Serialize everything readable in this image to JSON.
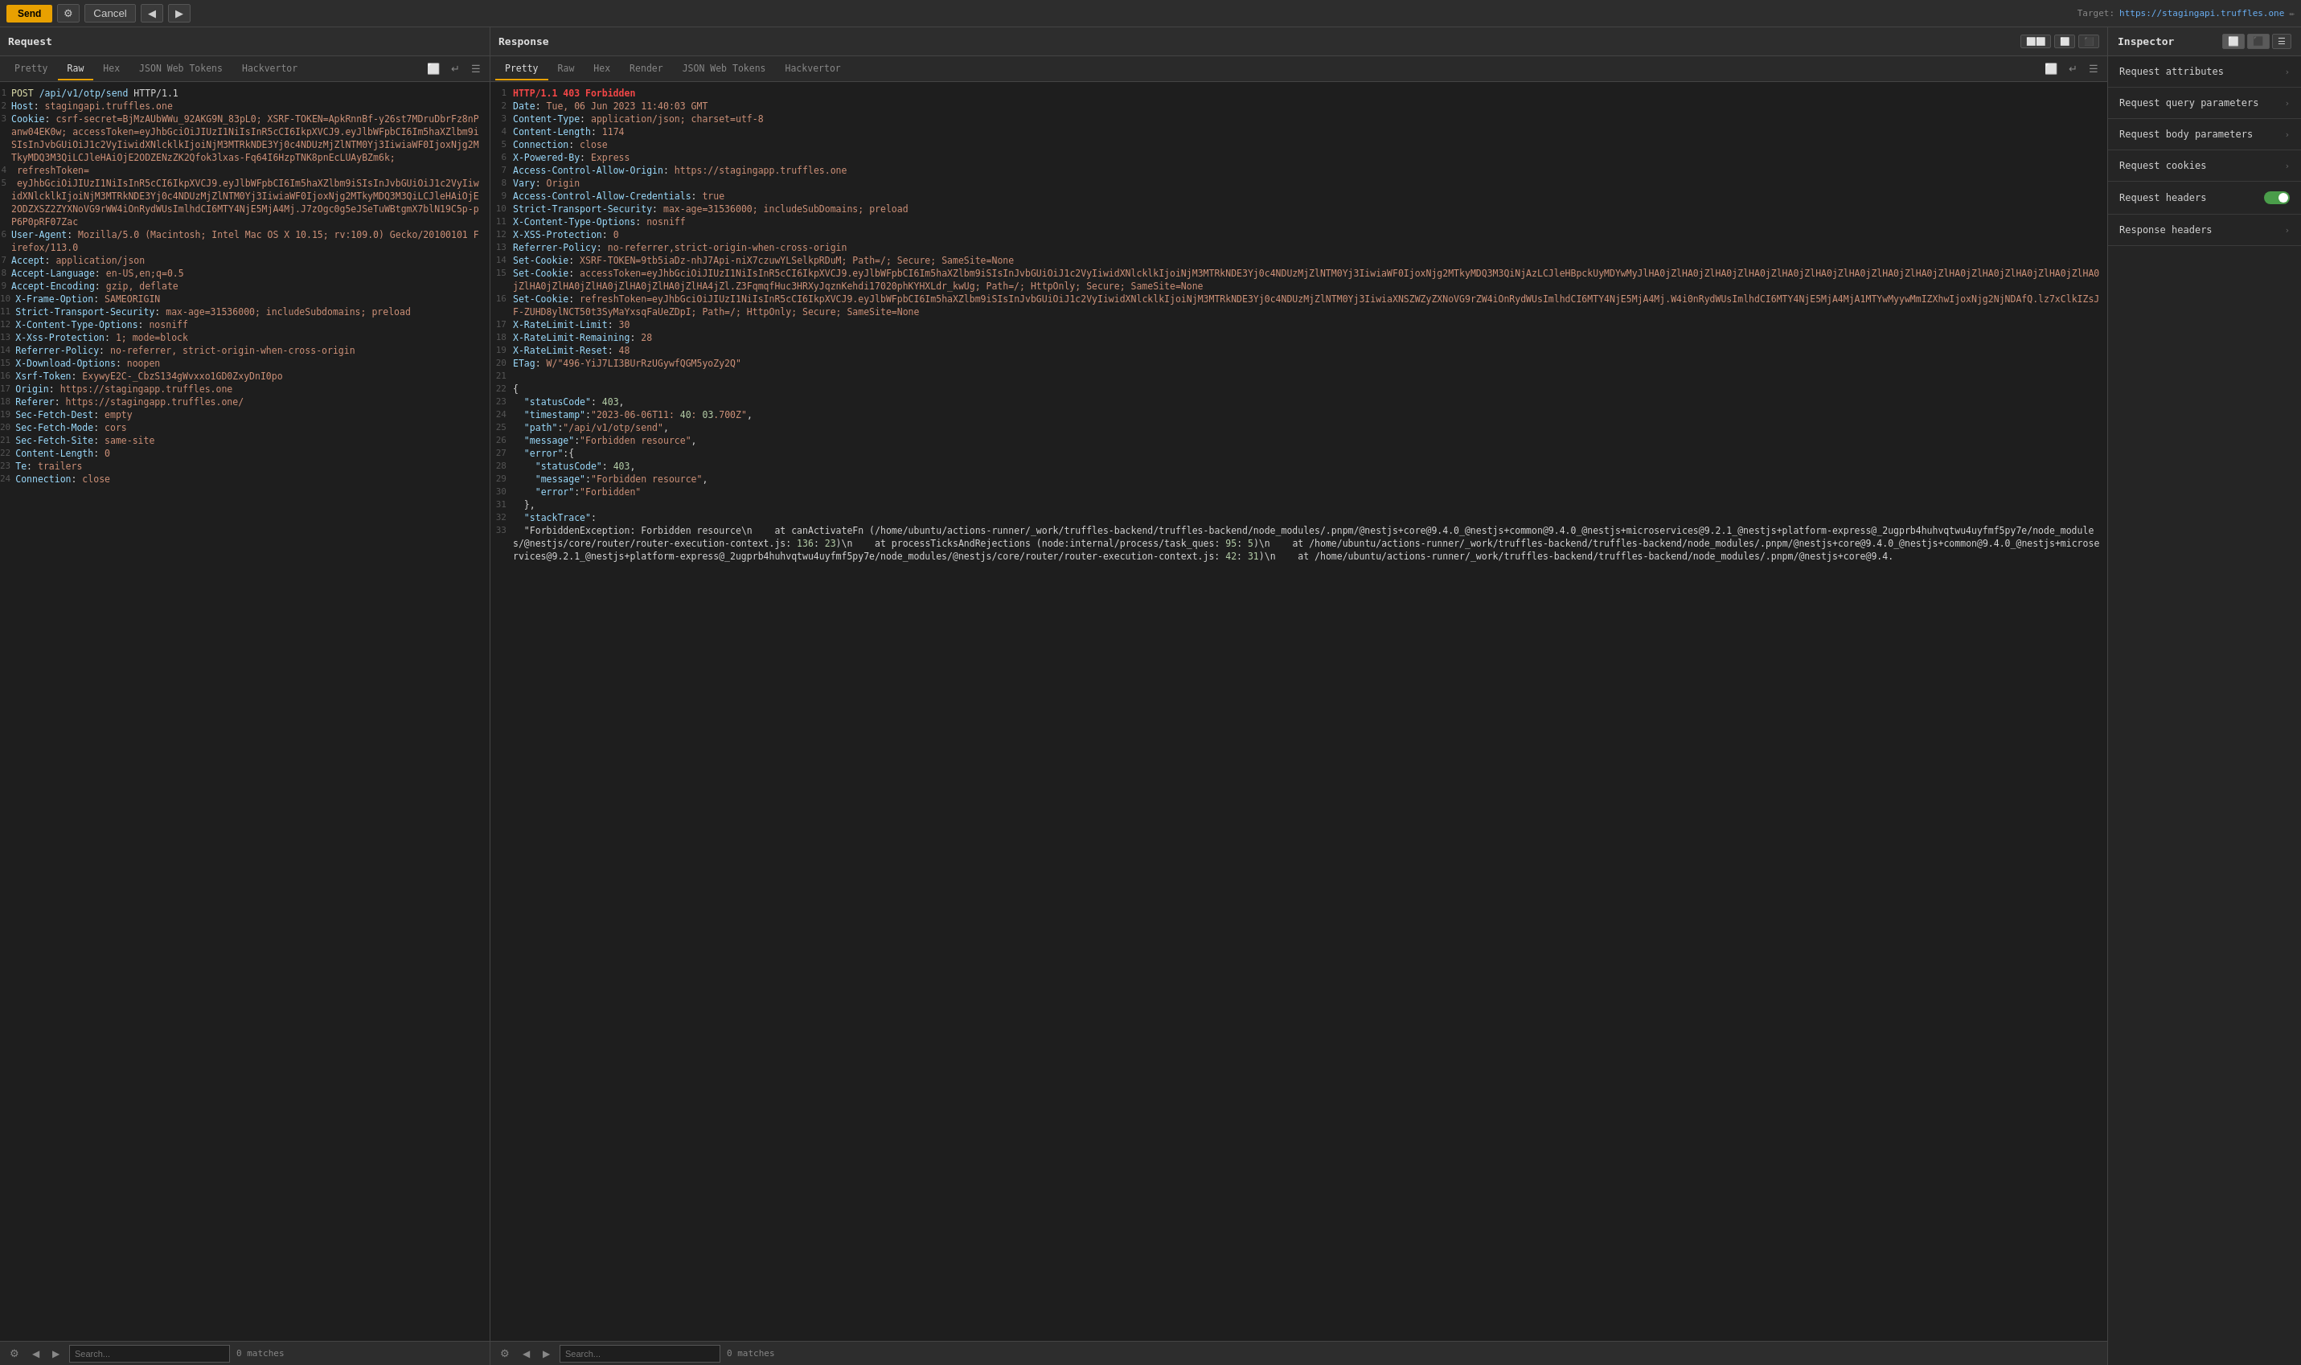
{
  "toolbar": {
    "send_label": "Send",
    "cancel_label": "Cancel",
    "target_prefix": "Target: ",
    "target_url": "https://stagingapi.truffles.one"
  },
  "request_panel": {
    "title": "Request",
    "tabs": [
      "Pretty",
      "Raw",
      "Hex",
      "JSON Web Tokens",
      "Hackvertor"
    ],
    "active_tab": "Raw"
  },
  "response_panel": {
    "title": "Response",
    "tabs": [
      "Pretty",
      "Raw",
      "Hex",
      "Render",
      "JSON Web Tokens",
      "Hackvertor"
    ],
    "active_tab": "Pretty"
  },
  "inspector": {
    "title": "Inspector",
    "items": [
      {
        "label": "Request attributes",
        "has_toggle": false
      },
      {
        "label": "Request query parameters",
        "has_toggle": false
      },
      {
        "label": "Request body parameters",
        "has_toggle": false
      },
      {
        "label": "Request cookies",
        "has_toggle": false
      },
      {
        "label": "Request headers",
        "has_toggle": true,
        "toggle_on": true
      },
      {
        "label": "Response headers",
        "has_toggle": false
      }
    ]
  },
  "request_search": {
    "placeholder": "Search...",
    "value": "",
    "matches": "0 matches"
  },
  "response_search": {
    "placeholder": "Search...",
    "value": "",
    "matches": "0 matches"
  },
  "request_lines": [
    {
      "content": "POST /api/v1/otp/send HTTP/1.1"
    },
    {
      "content": "Host: stagingapi.truffles.one"
    },
    {
      "content": "Cookie: csrf-secret=BjMzAUbWWu_92AKG9N_83pL0; XSRF-TOKEN=ApkRnnBf-y26st7MDruDbrFz8nPanw04EK0w; accessToken=eyJhbGciOiJIUzI1NiIsInR5cCI6IkpXVCJ9.eyJlbWFpbCI6Im5haXZlbm9iSIsInJvbGUiOiJ1c2VyIiwidXNlcklkIjoiNjM3MTRkNDE3Yj0c4NDUzMjZlNTM0Yj3IiwiaWF0IjoxNjg2MTkyMDQ3M3QiLCJleHAiOjE2ODZENzZK2Qfok3lxas-Fq64I6HzpTNK8pnEcLUAyBZm6k;"
    },
    {
      "content": " refreshToken="
    },
    {
      "content": " eyJhbGciOiJIUzI1NiIsInR5cCI6IkpXVCJ9.eyJlbWFpbCI6Im5haXZlbm9iSIsInJvbGUiOiJ1c2VyIiwidXNlcklkIjoiNjM3MTRkNDE3Yj0c4NDUzMjZlNTM0Yj3IiwiaWF0IjoxNjg2MTkyMDQ3M3QiLCJleHAiOjE2ODZXSZ2ZYXNoVG9rWW4iOnRydWUsImlhdCI6MTY4NjE5MjA4Mj.J7zOgc0g5eJSeTuWBtgmX7blN19C5p-pP6P0pRF07Zac"
    },
    {
      "content": "User-Agent: Mozilla/5.0 (Macintosh; Intel Mac OS X 10.15; rv:109.0) Gecko/20100101 Firefox/113.0"
    },
    {
      "content": "Accept: application/json"
    },
    {
      "content": "Accept-Language: en-US,en;q=0.5"
    },
    {
      "content": "Accept-Encoding: gzip, deflate"
    },
    {
      "content": "X-Frame-Option: SAMEORIGIN"
    },
    {
      "content": "Strict-Transport-Security: max-age=31536000; includeSubdomains; preload"
    },
    {
      "content": "X-Content-Type-Options: nosniff"
    },
    {
      "content": "X-Xss-Protection: 1; mode=block"
    },
    {
      "content": "Referrer-Policy: no-referrer, strict-origin-when-cross-origin"
    },
    {
      "content": "X-Download-Options: noopen"
    },
    {
      "content": "Xsrf-Token: ExywyE2C-_CbzS134gWvxxo1GD0ZxyDnI0po"
    },
    {
      "content": "Origin: https://stagingapp.truffles.one"
    },
    {
      "content": "Referer: https://stagingapp.truffles.one/"
    },
    {
      "content": "Sec-Fetch-Dest: empty"
    },
    {
      "content": "Sec-Fetch-Mode: cors"
    },
    {
      "content": "Sec-Fetch-Site: same-site"
    },
    {
      "content": "Content-Length: 0"
    },
    {
      "content": "Te: trailers"
    },
    {
      "content": "Connection: close"
    }
  ],
  "response_lines": [
    {
      "num": 1,
      "content": "HTTP/1.1 403 Forbidden",
      "type": "status"
    },
    {
      "num": 2,
      "content": "Date: Tue, 06 Jun 2023 11:40:03 GMT",
      "type": "header"
    },
    {
      "num": 3,
      "content": "Content-Type: application/json; charset=utf-8",
      "type": "header"
    },
    {
      "num": 4,
      "content": "Content-Length: 1174",
      "type": "header"
    },
    {
      "num": 5,
      "content": "Connection: close",
      "type": "header"
    },
    {
      "num": 6,
      "content": "X-Powered-By: Express",
      "type": "header"
    },
    {
      "num": 7,
      "content": "Access-Control-Allow-Origin: https://stagingapp.truffles.one",
      "type": "header"
    },
    {
      "num": 8,
      "content": "Vary: Origin",
      "type": "header"
    },
    {
      "num": 9,
      "content": "Access-Control-Allow-Credentials: true",
      "type": "header"
    },
    {
      "num": 10,
      "content": "Strict-Transport-Security: max-age=31536000; includeSubDomains; preload",
      "type": "header"
    },
    {
      "num": 11,
      "content": "X-Content-Type-Options: nosniff",
      "type": "header"
    },
    {
      "num": 12,
      "content": "X-XSS-Protection: 0",
      "type": "header"
    },
    {
      "num": 13,
      "content": "Referrer-Policy: no-referrer,strict-origin-when-cross-origin",
      "type": "header"
    },
    {
      "num": 14,
      "content": "Set-Cookie: XSRF-TOKEN=9tb5iaDz-nhJ7Api-niX7czuwYLSelkpRDuM; Path=/; Secure; SameSite=None",
      "type": "header"
    },
    {
      "num": 15,
      "content": "Set-Cookie: accessToken=eyJhbGciOiJIUzI1NiIsInR5cCI6IkpXVCJ9.eyJlbWFpbCI6Im5haXZlbm9iSIsInJvbGUiOiJ1c2VyIiwidXNlcklkIjoiNjM3MTRkNDE3Yj0c4NDUzMjZlNTM0Yj3IiwiaWF0IjoxNjg2MTkyMDQ3M3QiNjAzLCJleHBpckUyMDYwMyJlHA0jZlHA0jZlHA0jZlHA0jZlHA0jZlHA0jZlHA0jZlHA0jZlHA0jZlHA0jZlHA0jZlHA0jZlHA0jZlHA0jZlHA0jZlHA0jZlHA0jZlHA0jZlHA0jZlHA4jZl.Z3FqmqfHuc3HRXyJqznKehdi17020phKYHXLdr_kwUg; Path=/; HttpOnly; Secure; SameSite=None",
      "type": "header"
    },
    {
      "num": 16,
      "content": "Set-Cookie: refreshToken=eyJhbGciOiJIUzI1NiIsInR5cCI6IkpXVCJ9.eyJlbWFpbCI6Im5haXZlbm9iSIsInJvbGUiOiJ1c2VyIiwidXNlcklkIjoiNjM3MTRkNDE3Yj0c4NDUzMjZlNTM0Yj3IiwiaXNSZWZyZXNoVG9rZW4iOnRydWUsImlhdCI6MTY4NjE5MjA4Mj.W4i0nRydWUsImlhdCI6MTY4NjE5MjA4MjA1MTYwMyywMmIZXhwIjoxNjg2NjNDAfQ.lz7xClkIZsJF-ZUHD8ylNCT50t3SyMaYxsqFaUeZDpI; Path=/; HttpOnly; Secure; SameSite=None",
      "type": "header"
    },
    {
      "num": 17,
      "content": "X-RateLimit-Limit: 30",
      "type": "header"
    },
    {
      "num": 18,
      "content": "X-RateLimit-Remaining: 28",
      "type": "header"
    },
    {
      "num": 19,
      "content": "X-RateLimit-Reset: 48",
      "type": "header"
    },
    {
      "num": 20,
      "content": "ETag: W/\"496-YiJ7LI3BUrRzUGywfQGM5yoZy2Q\"",
      "type": "header"
    },
    {
      "num": 21,
      "content": "",
      "type": "blank"
    },
    {
      "num": 22,
      "content": "{",
      "type": "json"
    },
    {
      "num": 23,
      "content": "  \"statusCode\":403,",
      "type": "json"
    },
    {
      "num": 24,
      "content": "  \"timestamp\":\"2023-06-06T11:40:03.700Z\",",
      "type": "json"
    },
    {
      "num": 25,
      "content": "  \"path\":\"/api/v1/otp/send\",",
      "type": "json"
    },
    {
      "num": 26,
      "content": "  \"message\":\"Forbidden resource\",",
      "type": "json"
    },
    {
      "num": 27,
      "content": "  \"error\":{",
      "type": "json"
    },
    {
      "num": 28,
      "content": "    \"statusCode\":403,",
      "type": "json"
    },
    {
      "num": 29,
      "content": "    \"message\":\"Forbidden resource\",",
      "type": "json"
    },
    {
      "num": 30,
      "content": "    \"error\":\"Forbidden\"",
      "type": "json"
    },
    {
      "num": 31,
      "content": "  },",
      "type": "json"
    },
    {
      "num": 32,
      "content": "  \"stackTrace\":",
      "type": "json"
    },
    {
      "num": 33,
      "content": "  \"ForbiddenException: Forbidden resource\\n    at canActivateFn (/home/ubuntu/actions-runner/_work/truffles-backend/truffles-backend/node_modules/.pnpm/@nestjs+core@9.4.0_@nestjs+common@9.4.0_@nestjs+microservices@9.2.1_@nestjs+platform-express@_2ugprb4huhvqtwu4uyfmf5py7e/node_modules/@nestjs/core/router/router-execution-context.js:136:23)\\n    at processTicksAndRejections (node:internal/process/task_ques:95:5)\\n    at /home/ubuntu/actions-runner/_work/truffles-backend/truffles-backend/node_modules/.pnpm/@nestjs+core@9.4.0_@nestjs+common@9.4.0_@nestjs+microservices@9.2.1_@nestjs+platform-express@_2ugprb4huhvqtwu4uyfmf5py7e/node_modules/@nestjs/core/router/router-execution-context.js:42:31)\\n    at /home/ubuntu/actions-runner/_work/truffles-backend/truffles-backend/node_modules/.pnpm/@nestjs+core@9.4.",
      "type": "json"
    }
  ]
}
